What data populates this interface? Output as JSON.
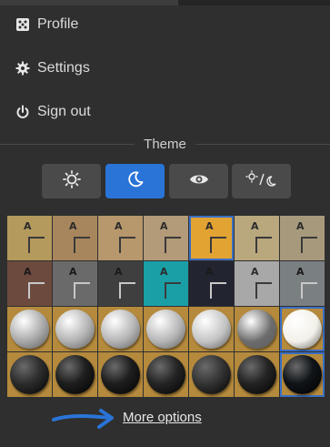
{
  "menu": {
    "profile_label": "Profile",
    "settings_label": "Settings",
    "signout_label": "Sign out"
  },
  "theme": {
    "heading": "Theme",
    "options": [
      {
        "icon": "sun-icon",
        "active": false
      },
      {
        "icon": "moon-icon",
        "active": true
      },
      {
        "icon": "eye-icon",
        "active": false
      },
      {
        "icon": "sun-moon-icon",
        "active": false
      }
    ]
  },
  "boards": {
    "letter": "A",
    "row1": [
      {
        "bg": "#b59a5d",
        "selected": false
      },
      {
        "bg": "#a7865e",
        "selected": false
      },
      {
        "bg": "#b7976c",
        "selected": false
      },
      {
        "bg": "#b39a78",
        "selected": false
      },
      {
        "bg": "#e3a332",
        "selected": true
      },
      {
        "bg": "#b9a77e",
        "selected": false
      },
      {
        "bg": "#a79a7c",
        "selected": false
      }
    ],
    "row2": [
      {
        "bg": "#6d4a3e",
        "selected": false
      },
      {
        "bg": "#6a6a6a",
        "selected": false
      },
      {
        "bg": "#3f3f3f",
        "selected": false
      },
      {
        "bg": "#1a9fa7",
        "selected": false
      },
      {
        "bg": "#222430",
        "selected": false
      },
      {
        "bg": "#a8a8a8",
        "selected": false
      },
      {
        "bg": "#7a7f82",
        "selected": false
      }
    ]
  },
  "stones": {
    "board_bg": "#b58a3c",
    "white_row": [
      {
        "color": "#a6a6a6",
        "selected": false
      },
      {
        "color": "#b0b0b0",
        "selected": false
      },
      {
        "color": "#b3b3b3",
        "selected": false
      },
      {
        "color": "#b4b4b4",
        "selected": false
      },
      {
        "color": "#c3c3c3",
        "selected": false
      },
      {
        "color": "#6c6c6c",
        "selected": false
      },
      {
        "color": "#f2f0e8",
        "selected": true
      }
    ],
    "black_row": [
      {
        "color": "#2d2d2d",
        "selected": false
      },
      {
        "color": "#1e1e1e",
        "selected": false
      },
      {
        "color": "#1e1e1e",
        "selected": false
      },
      {
        "color": "#252525",
        "selected": false
      },
      {
        "color": "#353535",
        "selected": false
      },
      {
        "color": "#242424",
        "selected": false
      },
      {
        "color": "#101418",
        "selected": true
      }
    ]
  },
  "footer": {
    "more_options_label": "More options",
    "arrow_color": "#2a74d8"
  }
}
